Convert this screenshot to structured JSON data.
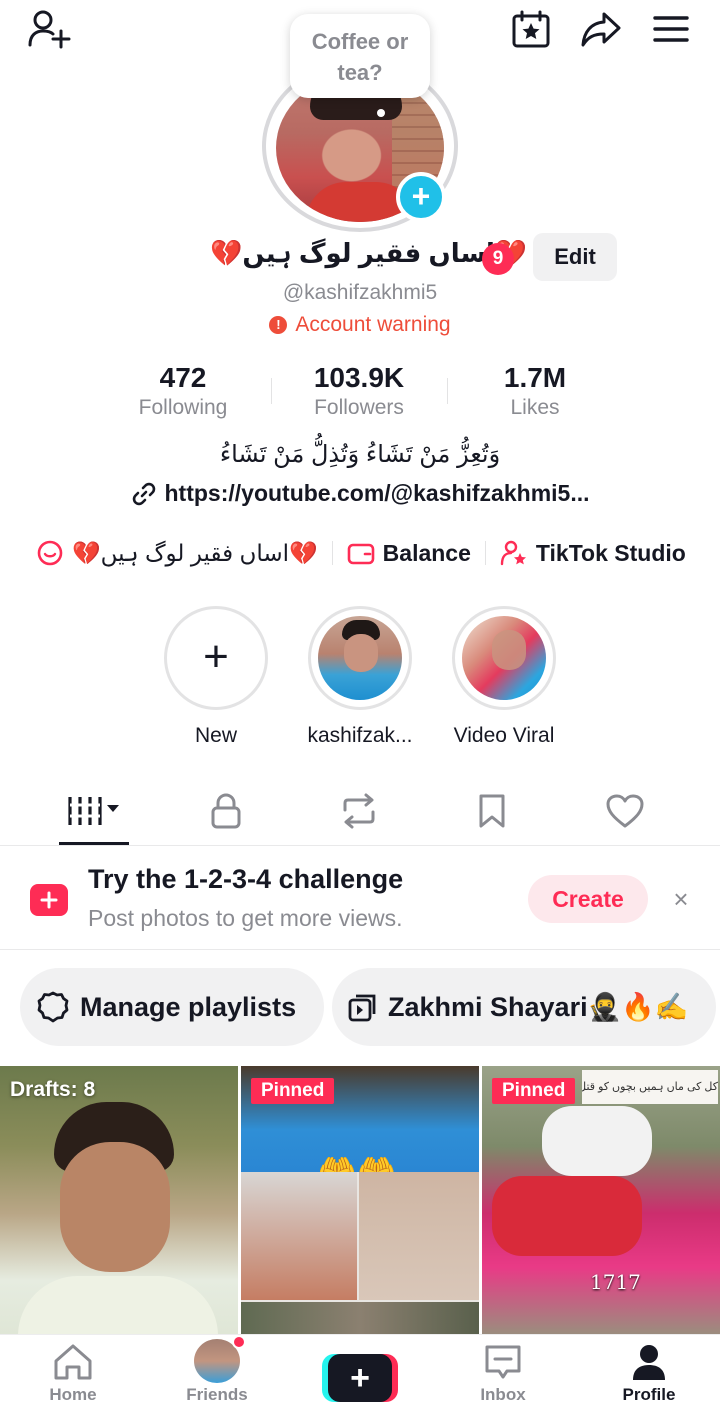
{
  "header": {
    "add_friend_icon": "person-plus-icon",
    "calendar_icon": "calendar-star-icon",
    "share_icon": "share-arrow-icon",
    "menu_icon": "hamburger-menu-icon"
  },
  "profile": {
    "status_bubble": "Coffee or tea?",
    "display_name": "💔اساں فقیر لوگ ہیں💔",
    "notification_count": "9",
    "edit_label": "Edit",
    "username": "@kashifzakhmi5",
    "warning_icon": "!",
    "warning_text": "Account warning"
  },
  "stats": [
    {
      "value": "472",
      "label": "Following"
    },
    {
      "value": "103.9K",
      "label": "Followers"
    },
    {
      "value": "1.7M",
      "label": "Likes"
    }
  ],
  "bio": {
    "text": "وَتُعِزُّ مَنْ تَشَاءُ وَتُذِلُّ مَنْ تَشَاءُ",
    "link": "https://youtube.com/@kashifzakhmi5..."
  },
  "shortcuts": [
    {
      "label": "💔اساں فقیر لوگ ہیں💔",
      "icon": "chat-bubble-icon"
    },
    {
      "label": "Balance",
      "icon": "wallet-icon"
    },
    {
      "label": "TikTok Studio",
      "icon": "person-star-icon"
    }
  ],
  "highlights": [
    {
      "label": "New",
      "icon": "+"
    },
    {
      "label": "kashifzak..."
    },
    {
      "label": "Video Viral"
    }
  ],
  "tabs": [
    "grid-videos-tab",
    "private-lock-tab",
    "repost-tab",
    "saved-bookmark-tab",
    "liked-heart-tab"
  ],
  "promo": {
    "title": "Try the 1-2-3-4 challenge",
    "subtitle": "Post photos to get more views.",
    "create_label": "Create",
    "close_label": "×"
  },
  "playlists": [
    {
      "label": "Manage playlists",
      "icon": "gear-icon"
    },
    {
      "label": "Zakhmi Shayari🥷🔥✍️",
      "icon": "playlist-icon"
    }
  ],
  "grid": [
    {
      "tag": "Drafts: 8"
    },
    {
      "tag": "Pinned",
      "emoji": "🤲🤲"
    },
    {
      "tag": "Pinned",
      "overlay_text": "1717",
      "top_text": "کل کی ماں ہمیں بچوں کو قتل کر دیا اج"
    }
  ],
  "bottom_nav": {
    "home": "Home",
    "friends": "Friends",
    "create": "+",
    "inbox": "Inbox",
    "profile": "Profile"
  },
  "colors": {
    "accent": "#fe2c55",
    "cyan": "#20c0e8",
    "warning": "#ee4d3a",
    "muted": "#8a8b91"
  }
}
